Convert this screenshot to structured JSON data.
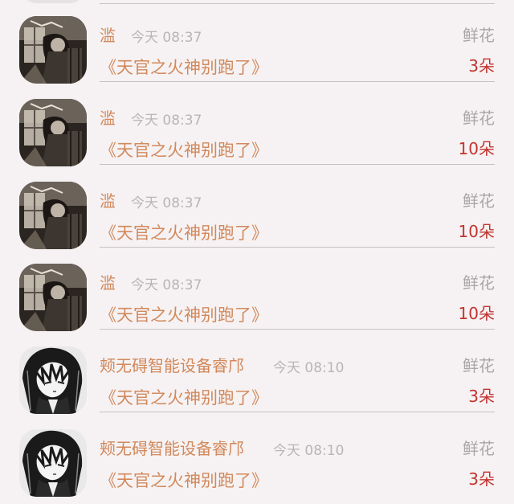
{
  "items": [
    {
      "user": "滥",
      "time": "今天 08:37",
      "gift": "鲜花",
      "book": "《天官之火神别跑了》",
      "count": "3朵",
      "avatar_icon": "anime-dark-room-avatar-icon"
    },
    {
      "user": "滥",
      "time": "今天 08:37",
      "gift": "鲜花",
      "book": "《天官之火神别跑了》",
      "count": "10朵",
      "avatar_icon": "anime-dark-room-avatar-icon"
    },
    {
      "user": "滥",
      "time": "今天 08:37",
      "gift": "鲜花",
      "book": "《天官之火神别跑了》",
      "count": "10朵",
      "avatar_icon": "anime-dark-room-avatar-icon"
    },
    {
      "user": "滥",
      "time": "今天 08:37",
      "gift": "鲜花",
      "book": "《天官之火神别跑了》",
      "count": "10朵",
      "avatar_icon": "anime-dark-room-avatar-icon"
    },
    {
      "user": "颊无碍智能设备睿邝",
      "time": "今天 08:10",
      "gift": "鲜花",
      "book": "《天官之火神别跑了》",
      "count": "3朵",
      "avatar_icon": "anime-monochrome-avatar-icon"
    },
    {
      "user": "颊无碍智能设备睿邝",
      "time": "今天 08:10",
      "gift": "鲜花",
      "book": "《天官之火神别跑了》",
      "count": "3朵",
      "avatar_icon": "anime-monochrome-avatar-icon"
    }
  ],
  "colors": {
    "background": "#f6f2f3",
    "accent_orange": "#d2895c",
    "count_red": "#c3342f",
    "muted_gray": "#aaa5a6",
    "divider": "#c6c0c1"
  }
}
